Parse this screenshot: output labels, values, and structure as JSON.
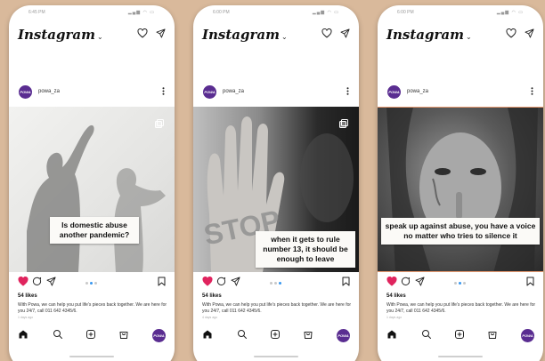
{
  "app": {
    "logo": "Instagram",
    "logo_chevron": "⌄"
  },
  "colors": {
    "background": "#d9b99b",
    "like_red": "#e0245e",
    "brand_purple": "#5a2d91",
    "carousel_active": "#3897f0"
  },
  "phones": [
    {
      "status_time": "6:45 PM",
      "username": "powa_za",
      "avatar_text": "POWA",
      "image_text": "Is domestic abuse another pandemic?",
      "likes": "54 likes",
      "caption": "With Powa, we can help you put life's pieces back together. We are here for you 24/7, call 011 642 4345/6.",
      "time_ago": "1 days ago",
      "active_dot": 1
    },
    {
      "status_time": "6:00 PM",
      "username": "powa_za",
      "avatar_text": "POWA",
      "image_text": "when it gets to rule number 13, it should be enough to leave",
      "likes": "54 likes",
      "caption": "With Powa, we can help you put life's pieces back together. We are here for you 24/7, call 011 642 4345/6.",
      "time_ago": "4 days ago",
      "active_dot": 2
    },
    {
      "status_time": "6:00 PM",
      "username": "powa_za",
      "avatar_text": "POWA",
      "image_text": "speak up against abuse, you have a voice no matter who tries to silence it",
      "likes": "54 likes",
      "caption": "With Powa, we can help you put life's pieces back together. We are here for you 24/7, call 011 642 4345/6.",
      "time_ago": "1 days ago",
      "active_dot": 1
    }
  ]
}
